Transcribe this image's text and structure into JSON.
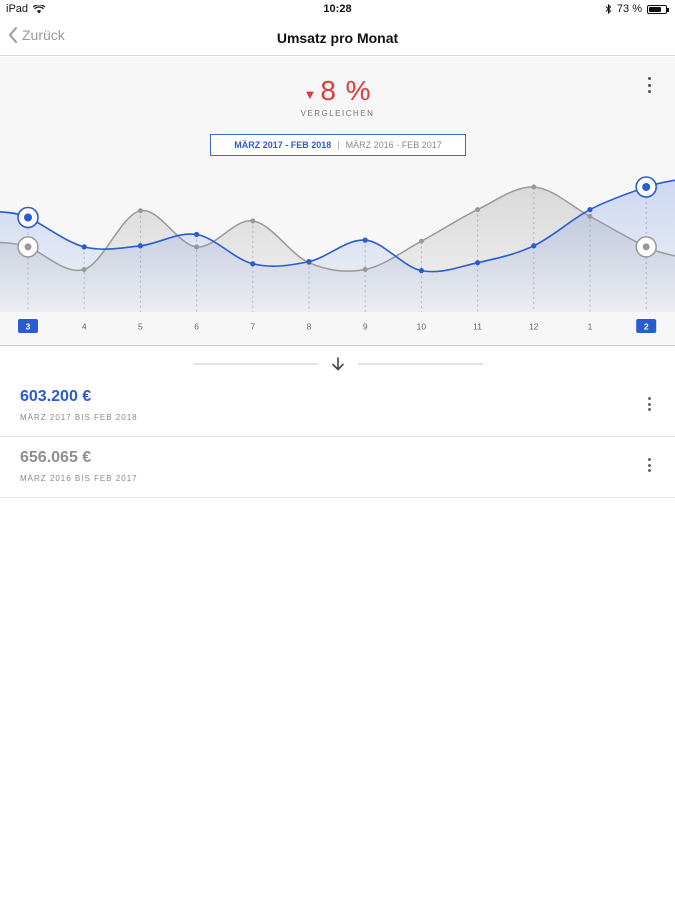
{
  "status_bar": {
    "device": "iPad",
    "time": "10:28",
    "battery": "73 %",
    "battery_level": 0.73
  },
  "nav": {
    "back_label": "Zurück",
    "title": "Umsatz pro Monat"
  },
  "summary": {
    "change_arrow": "▼",
    "change_value": "8 %",
    "compare_label": "VERGLEICHEN",
    "period_current": "MÄRZ 2017 - FEB 2018",
    "period_separator": "|",
    "period_previous": "MÄRZ 2016 - FEB 2017"
  },
  "colors": {
    "accent": "#2a5bd0",
    "negative": "#e0393b",
    "previous_series": "#999999"
  },
  "chart_data": {
    "type": "line",
    "categories": [
      "3",
      "4",
      "5",
      "6",
      "7",
      "8",
      "9",
      "10",
      "11",
      "12",
      "1",
      "2"
    ],
    "selected": [
      "3",
      "2"
    ],
    "series": [
      {
        "values": [
          0.73,
          0.47,
          0.48,
          0.58,
          0.32,
          0.34,
          0.53,
          0.26,
          0.33,
          0.48,
          0.8,
          1.0
        ]
      },
      {
        "values": [
          0.47,
          0.27,
          0.79,
          0.47,
          0.7,
          0.33,
          0.27,
          0.52,
          0.8,
          1.0,
          0.74,
          0.47
        ]
      }
    ]
  },
  "totals": [
    {
      "value": "603.200 €",
      "period": "MÄRZ 2017 BIS FEB 2018",
      "color": "#2a5bd0"
    },
    {
      "value": "656.065 €",
      "period": "MÄRZ 2016 BIS FEB 2017",
      "color": "#8f8f8f"
    }
  ]
}
